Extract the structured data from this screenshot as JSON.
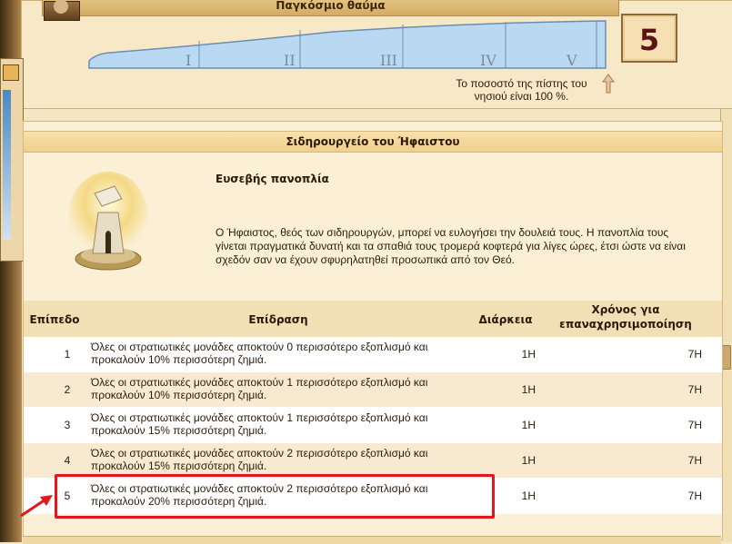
{
  "wonder": {
    "title": "Παγκόσμιο θαύμα",
    "stages": [
      "I",
      "II",
      "III",
      "IV",
      "V"
    ],
    "current_level": "5",
    "faith_text": "Το ποσοστό της πίστης του νησιού είναι 100 %."
  },
  "building": {
    "name": "Σιδηρουργείο του Ήφαιστου",
    "spell_name": "Ευσεβής πανοπλία",
    "description": "Ο Ήφαιστος, θεός των σιδηρουργών, μπορεί να ευλογήσει την δουλειά τους. Η πανοπλία τους γίνεται πραγματικά δυνατή και τα σπαθιά τους τρομερά κοφτερά για λίγες ώρες, έτσι ώστε να είναι σχεδόν σαν να έχουν σφυρηλατηθεί προσωπικά από τον Θεό."
  },
  "table": {
    "headers": {
      "level": "Επίπεδο",
      "effect": "Επίδραση",
      "duration": "Διάρκεια",
      "cooldown": "Χρόνος για επαναχρησιμοποίηση"
    },
    "rows": [
      {
        "level": "1",
        "effect": "Όλες οι στρατιωτικές μονάδες αποκτούν 0 περισσότερο εξοπλισμό και προκαλούν 10% περισσότερη ζημιά.",
        "duration": "1H",
        "cooldown": "7H"
      },
      {
        "level": "2",
        "effect": "Όλες οι στρατιωτικές μονάδες αποκτούν 1 περισσότερο εξοπλισμό και προκαλούν 10% περισσότερη ζημιά.",
        "duration": "1H",
        "cooldown": "7H"
      },
      {
        "level": "3",
        "effect": "Όλες οι στρατιωτικές μονάδες αποκτούν 1 περισσότερο εξοπλισμό και προκαλούν 15% περισσότερη ζημιά.",
        "duration": "1H",
        "cooldown": "7H"
      },
      {
        "level": "4",
        "effect": "Όλες οι στρατιωτικές μονάδες αποκτούν 2 περισσότερο εξοπλισμό και προκαλούν 15% περισσότερη ζημιά.",
        "duration": "1H",
        "cooldown": "7H"
      },
      {
        "level": "5",
        "effect": "Όλες οι στρατιωτικές μονάδες αποκτούν 2 περισσότερο εξοπλισμό και προκαλούν 20% περισσότερη ζημιά.",
        "duration": "1H",
        "cooldown": "7H"
      }
    ],
    "highlighted_level": "5"
  },
  "colors": {
    "panel": "#fbf0d6",
    "header": "#f2dfb6",
    "row_even": "#ffffff",
    "row_odd": "#f7ead0",
    "progress_fill": "#b9d9f2",
    "highlight": "#e3161c"
  },
  "icons": [
    "temple-avatar-icon",
    "up-arrow-icon",
    "forge-spell-icon",
    "red-pointer-arrow-icon"
  ]
}
